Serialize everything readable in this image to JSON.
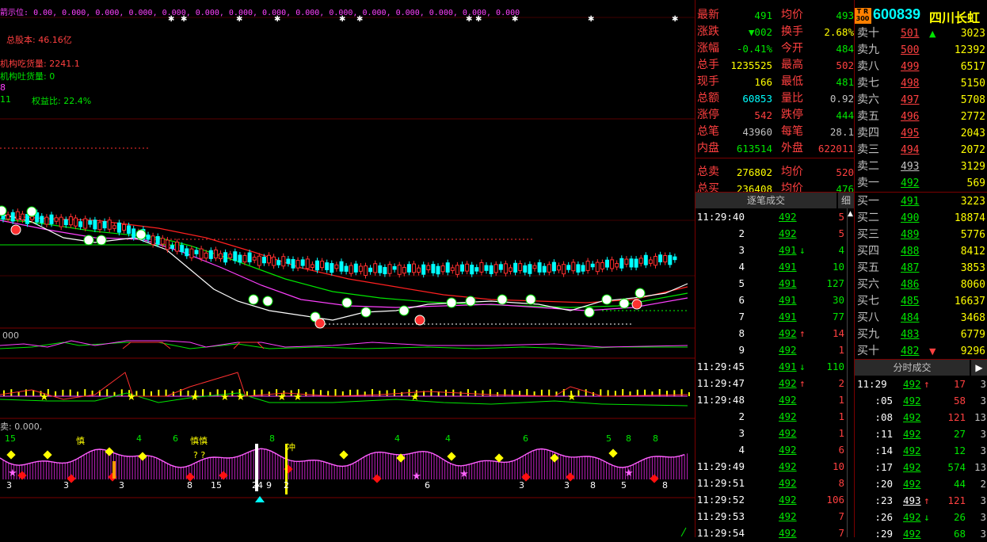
{
  "chart": {
    "top_indicator": {
      "label": "箭示位:",
      "values": "0.00,  0.000, 0.000,  0.000, 0.000,  0.000, 0.000,  0.000,  0.000, 0.000,  0.000, 0.000,  0.000, 0.000,  0.000"
    },
    "overlay_lines": [
      {
        "text": "总股本: 46.16亿",
        "color": "#ff4040"
      },
      {
        "text": "机构吃货量: 2241.1",
        "color": "#ff4040"
      },
      {
        "text": "机构吐货量: 0",
        "color": "#00e600"
      },
      {
        "text": "8",
        "color": "#ff40ff"
      },
      {
        "text": "11",
        "color": "#00e600"
      },
      {
        "text": "权益比: 22.4%",
        "color": "#00e600"
      }
    ],
    "sub_labels": {
      "indicator1": "000",
      "indicator3": "卖: 0.000,",
      "n15": "15",
      "n4a": "4",
      "n6": "6",
      "n8a": "8",
      "n4b": "4",
      "n4c": "4",
      "n6b": "6",
      "n5": "5",
      "n8b": "8",
      "n8c": "8",
      "shen1": "慎",
      "shen2": "慎慎",
      "qq": "? ?",
      "chong": "冲",
      "b3a": "3",
      "b3b": "3",
      "b3c": "3",
      "b3d": "3",
      "b8a": "8",
      "b15": "15",
      "b24": "24",
      "b9": "9",
      "b2": "2",
      "b6": "6",
      "b3e": "3",
      "b3f": "3",
      "b8b": "8",
      "b5": "5",
      "b8c": "8"
    }
  },
  "quote": {
    "rows": [
      {
        "l1": "最新",
        "v1": "491",
        "c1": "#00e600",
        "l2": "均价",
        "v2": "493",
        "c2": "#00e600"
      },
      {
        "l1": "涨跌",
        "v1": "▼002",
        "c1": "#00e600",
        "l2": "换手",
        "v2": "2.68%",
        "c2": "#ffff00"
      },
      {
        "l1": "涨幅",
        "v1": "-0.41%",
        "c1": "#00e600",
        "l2": "今开",
        "v2": "484",
        "c2": "#00e600"
      },
      {
        "l1": "总手",
        "v1": "1235525",
        "c1": "#ffff00",
        "l2": "最高",
        "v2": "502",
        "c2": "#ff4040"
      },
      {
        "l1": "现手",
        "v1": "166",
        "c1": "#ffff00",
        "l2": "最低",
        "v2": "481",
        "c2": "#00e600"
      },
      {
        "l1": "总额",
        "v1": "60853",
        "c1": "#00ffff",
        "l2": "量比",
        "v2": "0.92",
        "c2": "#c0c0c0"
      },
      {
        "l1": "涨停",
        "v1": "542",
        "c1": "#ff4040",
        "l2": "跌停",
        "v2": "444",
        "c2": "#00e600"
      },
      {
        "l1": "总笔",
        "v1": "43960",
        "c1": "#c0c0c0",
        "l2": "每笔",
        "v2": "28.1",
        "c2": "#c0c0c0"
      },
      {
        "l1": "内盘",
        "v1": "613514",
        "c1": "#00e600",
        "l2": "外盘",
        "v2": "622011",
        "c2": "#ff4040"
      },
      {
        "l1": "总卖",
        "v1": "276802",
        "c1": "#ffff00",
        "l2": "均价",
        "v2": "520",
        "c2": "#ff4040"
      },
      {
        "l1": "总买",
        "v1": "236408",
        "c1": "#ffff00",
        "l2": "均价",
        "v2": "476",
        "c2": "#00e600"
      }
    ]
  },
  "stock": {
    "badge_top": "T R",
    "badge_bottom": "300",
    "code": "600839",
    "name": "四川长虹"
  },
  "order_book": {
    "rows": [
      {
        "label": "卖十",
        "price": "501",
        "pc": "#ff4040",
        "arrow": "▲",
        "ac": "#00e600",
        "vol": "3023"
      },
      {
        "label": "卖九",
        "price": "500",
        "pc": "#ff4040",
        "arrow": "",
        "ac": "",
        "vol": "12392"
      },
      {
        "label": "卖八",
        "price": "499",
        "pc": "#ff4040",
        "arrow": "",
        "ac": "",
        "vol": "6517"
      },
      {
        "label": "卖七",
        "price": "498",
        "pc": "#ff4040",
        "arrow": "",
        "ac": "",
        "vol": "5150"
      },
      {
        "label": "卖六",
        "price": "497",
        "pc": "#ff4040",
        "arrow": "",
        "ac": "",
        "vol": "5708"
      },
      {
        "label": "卖五",
        "price": "496",
        "pc": "#ff4040",
        "arrow": "",
        "ac": "",
        "vol": "2772"
      },
      {
        "label": "卖四",
        "price": "495",
        "pc": "#ff4040",
        "arrow": "",
        "ac": "",
        "vol": "2043"
      },
      {
        "label": "卖三",
        "price": "494",
        "pc": "#ff4040",
        "arrow": "",
        "ac": "",
        "vol": "2072"
      },
      {
        "label": "卖二",
        "price": "493",
        "pc": "#c0c0c0",
        "arrow": "",
        "ac": "",
        "vol": "3129"
      },
      {
        "label": "卖一",
        "price": "492",
        "pc": "#00e600",
        "arrow": "",
        "ac": "",
        "vol": "569"
      },
      {
        "label": "买一",
        "price": "491",
        "pc": "#00e600",
        "arrow": "",
        "ac": "",
        "vol": "3223"
      },
      {
        "label": "买二",
        "price": "490",
        "pc": "#00e600",
        "arrow": "",
        "ac": "",
        "vol": "18874"
      },
      {
        "label": "买三",
        "price": "489",
        "pc": "#00e600",
        "arrow": "",
        "ac": "",
        "vol": "5776"
      },
      {
        "label": "买四",
        "price": "488",
        "pc": "#00e600",
        "arrow": "",
        "ac": "",
        "vol": "8412"
      },
      {
        "label": "买五",
        "price": "487",
        "pc": "#00e600",
        "arrow": "",
        "ac": "",
        "vol": "3853"
      },
      {
        "label": "买六",
        "price": "486",
        "pc": "#00e600",
        "arrow": "",
        "ac": "",
        "vol": "8060"
      },
      {
        "label": "买七",
        "price": "485",
        "pc": "#00e600",
        "arrow": "",
        "ac": "",
        "vol": "16637"
      },
      {
        "label": "买八",
        "price": "484",
        "pc": "#00e600",
        "arrow": "",
        "ac": "",
        "vol": "3468"
      },
      {
        "label": "买九",
        "price": "483",
        "pc": "#00e600",
        "arrow": "",
        "ac": "",
        "vol": "6779"
      },
      {
        "label": "买十",
        "price": "482",
        "pc": "#00e600",
        "arrow": "▼",
        "ac": "#ff4040",
        "vol": "9296"
      }
    ]
  },
  "tick_trades": {
    "header": "逐笔成交",
    "detail_button": "细",
    "rows": [
      {
        "time": "11:29:40",
        "price": "492",
        "pc": "#00e600",
        "arrow": "",
        "ac": "",
        "vol": "5",
        "vc": "#ff4040"
      },
      {
        "time": "2",
        "price": "492",
        "pc": "#00e600",
        "arrow": "",
        "ac": "",
        "vol": "5",
        "vc": "#ff4040"
      },
      {
        "time": "3",
        "price": "491",
        "pc": "#00e600",
        "arrow": "↓",
        "ac": "#00e600",
        "vol": "4",
        "vc": "#00e600"
      },
      {
        "time": "4",
        "price": "491",
        "pc": "#00e600",
        "arrow": "",
        "ac": "",
        "vol": "10",
        "vc": "#00e600"
      },
      {
        "time": "5",
        "price": "491",
        "pc": "#00e600",
        "arrow": "",
        "ac": "",
        "vol": "127",
        "vc": "#00e600"
      },
      {
        "time": "6",
        "price": "491",
        "pc": "#00e600",
        "arrow": "",
        "ac": "",
        "vol": "30",
        "vc": "#00e600"
      },
      {
        "time": "7",
        "price": "491",
        "pc": "#00e600",
        "arrow": "",
        "ac": "",
        "vol": "77",
        "vc": "#00e600"
      },
      {
        "time": "8",
        "price": "492",
        "pc": "#00e600",
        "arrow": "↑",
        "ac": "#ff4040",
        "vol": "14",
        "vc": "#ff4040"
      },
      {
        "time": "9",
        "price": "492",
        "pc": "#00e600",
        "arrow": "",
        "ac": "",
        "vol": "1",
        "vc": "#ff4040"
      },
      {
        "time": "11:29:45",
        "price": "491",
        "pc": "#00e600",
        "arrow": "↓",
        "ac": "#00e600",
        "vol": "110",
        "vc": "#00e600"
      },
      {
        "time": "11:29:47",
        "price": "492",
        "pc": "#00e600",
        "arrow": "↑",
        "ac": "#ff4040",
        "vol": "2",
        "vc": "#ff4040"
      },
      {
        "time": "11:29:48",
        "price": "492",
        "pc": "#00e600",
        "arrow": "",
        "ac": "",
        "vol": "1",
        "vc": "#ff4040"
      },
      {
        "time": "2",
        "price": "492",
        "pc": "#00e600",
        "arrow": "",
        "ac": "",
        "vol": "1",
        "vc": "#ff4040"
      },
      {
        "time": "3",
        "price": "492",
        "pc": "#00e600",
        "arrow": "",
        "ac": "",
        "vol": "1",
        "vc": "#ff4040"
      },
      {
        "time": "4",
        "price": "492",
        "pc": "#00e600",
        "arrow": "",
        "ac": "",
        "vol": "6",
        "vc": "#ff4040"
      },
      {
        "time": "11:29:49",
        "price": "492",
        "pc": "#00e600",
        "arrow": "",
        "ac": "",
        "vol": "10",
        "vc": "#ff4040"
      },
      {
        "time": "11:29:51",
        "price": "492",
        "pc": "#00e600",
        "arrow": "",
        "ac": "",
        "vol": "8",
        "vc": "#ff4040"
      },
      {
        "time": "11:29:52",
        "price": "492",
        "pc": "#00e600",
        "arrow": "",
        "ac": "",
        "vol": "106",
        "vc": "#ff4040"
      },
      {
        "time": "11:29:53",
        "price": "492",
        "pc": "#00e600",
        "arrow": "",
        "ac": "",
        "vol": "7",
        "vc": "#ff4040"
      },
      {
        "time": "11:29:54",
        "price": "492",
        "pc": "#00e600",
        "arrow": "",
        "ac": "",
        "vol": "7",
        "vc": "#ff4040"
      }
    ]
  },
  "time_trades": {
    "header": "分时成交",
    "rows": [
      {
        "time": "11:29",
        "price": "492",
        "pc": "#00e600",
        "arrow": "↑",
        "ac": "#ff4040",
        "vol": "17",
        "vc": "#ff4040",
        "extra": "3"
      },
      {
        "time": ":05",
        "price": "492",
        "pc": "#00e600",
        "arrow": "",
        "ac": "",
        "vol": "58",
        "vc": "#ff4040",
        "extra": "3"
      },
      {
        "time": ":08",
        "price": "492",
        "pc": "#00e600",
        "arrow": "",
        "ac": "",
        "vol": "121",
        "vc": "#ff4040",
        "extra": "13"
      },
      {
        "time": ":11",
        "price": "492",
        "pc": "#00e600",
        "arrow": "",
        "ac": "",
        "vol": "27",
        "vc": "#00e600",
        "extra": "3"
      },
      {
        "time": ":14",
        "price": "492",
        "pc": "#00e600",
        "arrow": "",
        "ac": "",
        "vol": "12",
        "vc": "#00e600",
        "extra": "3"
      },
      {
        "time": ":17",
        "price": "492",
        "pc": "#00e600",
        "arrow": "",
        "ac": "",
        "vol": "574",
        "vc": "#00e600",
        "extra": "13"
      },
      {
        "time": ":20",
        "price": "492",
        "pc": "#00e600",
        "arrow": "",
        "ac": "",
        "vol": "44",
        "vc": "#00e600",
        "extra": "2"
      },
      {
        "time": ":23",
        "price": "493",
        "pc": "#ffffff",
        "arrow": "↑",
        "ac": "#ff4040",
        "vol": "121",
        "vc": "#ff4040",
        "extra": "3"
      },
      {
        "time": ":26",
        "price": "492",
        "pc": "#00e600",
        "arrow": "↓",
        "ac": "#00e600",
        "vol": "26",
        "vc": "#00e600",
        "extra": "3"
      },
      {
        "time": ":29",
        "price": "492",
        "pc": "#00e600",
        "arrow": "",
        "ac": "",
        "vol": "68",
        "vc": "#00e600",
        "extra": "3"
      }
    ]
  }
}
